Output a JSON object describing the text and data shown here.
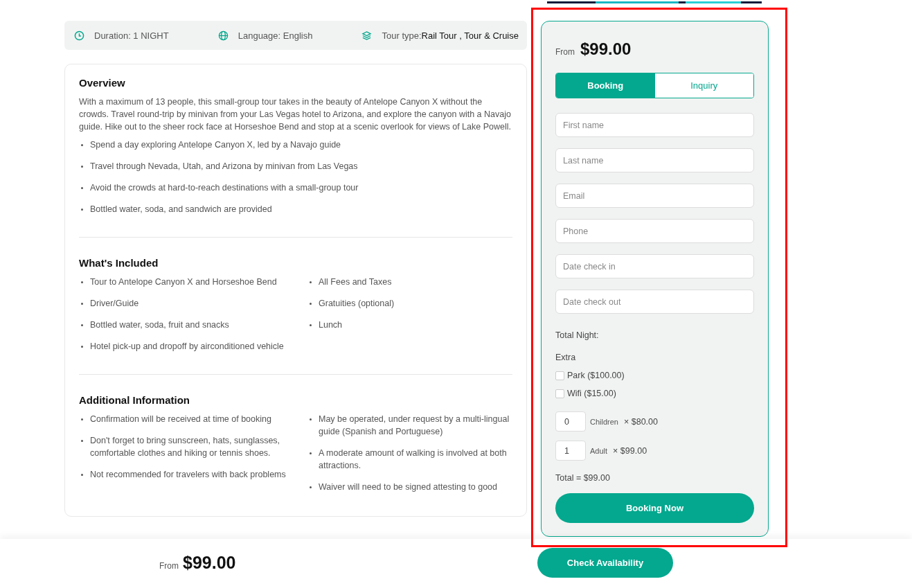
{
  "info_bar": [
    {
      "kind": "duration",
      "label": "Duration: 1 NIGHT"
    },
    {
      "kind": "language",
      "label": "Language: English"
    },
    {
      "kind": "tour_type",
      "label": "Tour type:",
      "value": "Rail Tour , Tour & Cruise"
    }
  ],
  "sections": [
    {
      "title": "Overview",
      "paragraph": "With a maximum of 13 people, this small-group tour takes in the beauty of Antelope Canyon X without the crowds. Travel round-trip by minivan from your Las Vegas hotel to Arizona, and explore the canyon with a Navajo guide. Hike out to the sheer rock face at Horseshoe Bend and stop at a scenic overlook for views of Lake Powell.",
      "columns": [
        [
          "Spend a day exploring Antelope Canyon X, led by a Navajo guide",
          "Travel through Nevada, Utah, and Arizona by minivan from Las Vegas",
          "Avoid the crowds at hard-to-reach destinations with a small-group tour",
          "Bottled water, soda, and sandwich are provided"
        ]
      ]
    },
    {
      "title": "What's Included",
      "columns": [
        [
          "Tour to Antelope Canyon X and Horseshoe Bend",
          "Driver/Guide",
          "Bottled water, soda, fruit and snacks",
          "Hotel pick-up and dropoff by airconditioned vehicle"
        ],
        [
          "All Fees and Taxes",
          "Gratuities (optional)",
          "Lunch"
        ]
      ]
    },
    {
      "title": "Additional Information",
      "columns": [
        [
          "Confirmation will be received at time of booking",
          "Don't forget to bring sunscreen, hats, sunglasses, comfortable clothes and hiking or tennis shoes.",
          "Not recommended for travelers with back problems"
        ],
        [
          "May be operated, under request by a multi-lingual guide (Spanish and Portuguese)",
          "A moderate amount of walking is involved at both attractions.",
          "Waiver will need to be signed attesting to good"
        ]
      ]
    }
  ],
  "booking": {
    "price_label": "From",
    "price": "$99.00",
    "tabs": [
      {
        "label": "Booking",
        "selected": true
      },
      {
        "label": "Inquiry",
        "selected": false
      }
    ],
    "fields": [
      {
        "placeholder": "First name"
      },
      {
        "placeholder": "Last name"
      },
      {
        "placeholder": "Email"
      },
      {
        "placeholder": "Phone"
      },
      {
        "placeholder": "Date check in"
      },
      {
        "placeholder": "Date check out"
      }
    ],
    "total_night": "Total Night:",
    "extra_label": "Extra",
    "extras": [
      {
        "label": "Park ($100.00)",
        "checked": false
      },
      {
        "label": "Wifi ($15.00)",
        "checked": false
      }
    ],
    "guests": [
      {
        "value": "0",
        "label": "Children",
        "price": "× $80.00"
      },
      {
        "value": "1",
        "label": "Adult",
        "price": "× $99.00"
      }
    ],
    "total": "Total = $99.00",
    "submit": "Booking Now"
  },
  "footer": {
    "price_label": "From",
    "price": "$99.00",
    "button": "Check Availability"
  }
}
